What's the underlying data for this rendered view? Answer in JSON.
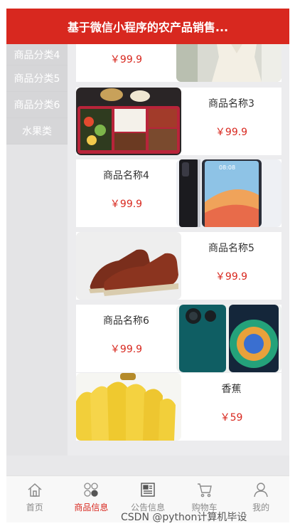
{
  "header": {
    "title": "基于微信小程序的农产品销售..."
  },
  "sidebar": {
    "items": [
      {
        "label": "商品分类4"
      },
      {
        "label": "商品分类5"
      },
      {
        "label": "商品分类6"
      },
      {
        "label": "水果类"
      }
    ]
  },
  "products": [
    {
      "name": "",
      "price": "￥99.9",
      "image": "clothing-image"
    },
    {
      "name": "商品名称3",
      "price": "￥99.9",
      "image": "bento-food-image"
    },
    {
      "name": "商品名称4",
      "price": "￥99.9",
      "image": "smartphone-image"
    },
    {
      "name": "商品名称5",
      "price": "￥99.9",
      "image": "leather-shoes-image"
    },
    {
      "name": "商品名称6",
      "price": "￥99.9",
      "image": "smartphone-green-image"
    },
    {
      "name": "香蕉",
      "price": "￥59",
      "image": "banana-image"
    }
  ],
  "tabbar": {
    "items": [
      {
        "label": "首页",
        "icon": "home-icon"
      },
      {
        "label": "商品信息",
        "icon": "category-icon"
      },
      {
        "label": "公告信息",
        "icon": "news-icon"
      },
      {
        "label": "购物车",
        "icon": "cart-icon"
      },
      {
        "label": "我的",
        "icon": "user-icon"
      }
    ]
  },
  "watermark": "CSDN @python计算机毕设",
  "colors": {
    "accent": "#d8281f",
    "background": "#ececee"
  }
}
